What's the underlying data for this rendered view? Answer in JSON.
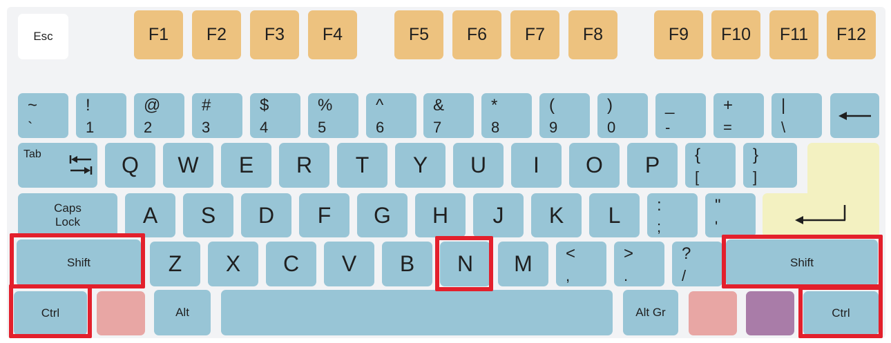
{
  "colors": {
    "function_key": "#edc27f",
    "main_key": "#98c5d6",
    "enter_key": "#f3f1c1",
    "meta_key_left": "#e8a6a4",
    "meta_key_right": "#a97ca8",
    "highlight": "#e3202c"
  },
  "esc": "Esc",
  "function_keys": [
    "F1",
    "F2",
    "F3",
    "F4",
    "F5",
    "F6",
    "F7",
    "F8",
    "F9",
    "F10",
    "F11",
    "F12"
  ],
  "number_row": [
    {
      "top": "~",
      "bot": "`"
    },
    {
      "top": "!",
      "bot": "1"
    },
    {
      "top": "@",
      "bot": "2"
    },
    {
      "top": "#",
      "bot": "3"
    },
    {
      "top": "$",
      "bot": "4"
    },
    {
      "top": "%",
      "bot": "5"
    },
    {
      "top": "^",
      "bot": "6"
    },
    {
      "top": "&",
      "bot": "7"
    },
    {
      "top": "*",
      "bot": "8"
    },
    {
      "top": "(",
      "bot": "9"
    },
    {
      "top": ")",
      "bot": "0"
    },
    {
      "top": "_",
      "bot": "-"
    },
    {
      "top": "+",
      "bot": "="
    },
    {
      "top": "|",
      "bot": "\\"
    }
  ],
  "tab": "Tab",
  "qwerty": [
    "Q",
    "W",
    "E",
    "R",
    "T",
    "Y",
    "U",
    "I",
    "O",
    "P"
  ],
  "brackets": [
    {
      "top": "{",
      "bot": "["
    },
    {
      "top": "}",
      "bot": "]"
    }
  ],
  "caps": {
    "line1": "Caps",
    "line2": "Lock"
  },
  "asdf": [
    "A",
    "S",
    "D",
    "F",
    "G",
    "H",
    "J",
    "K",
    "L"
  ],
  "home_punct": [
    {
      "top": ":",
      "bot": ";"
    },
    {
      "top": "\"",
      "bot": "'"
    }
  ],
  "shift": "Shift",
  "zxcv": [
    "Z",
    "X",
    "C",
    "V",
    "B",
    "N",
    "M"
  ],
  "bottom_punct": [
    {
      "top": "<",
      "bot": ","
    },
    {
      "top": ">",
      "bot": "."
    },
    {
      "top": "?",
      "bot": "/"
    }
  ],
  "ctrl": "Ctrl",
  "alt": "Alt",
  "altgr": "Alt Gr",
  "icons": {
    "backspace": "left-arrow-icon",
    "tab": "tab-arrows-icon",
    "enter": "enter-arrow-icon"
  },
  "highlighted_keys": [
    "Shift",
    "Ctrl",
    "N",
    "Shift",
    "Ctrl"
  ]
}
